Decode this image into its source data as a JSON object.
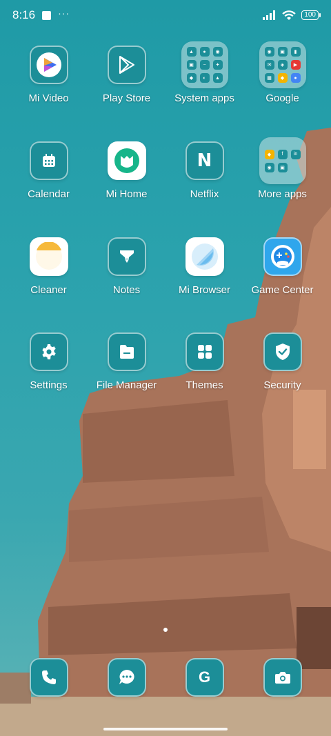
{
  "status_bar": {
    "time": "8:16",
    "extra": "···",
    "battery": "100"
  },
  "rows": [
    [
      {
        "label": "Mi Video",
        "icon": "mi-video-icon"
      },
      {
        "label": "Play Store",
        "icon": "play-store-icon"
      },
      {
        "label": "System apps",
        "icon": "folder-icon"
      },
      {
        "label": "Google",
        "icon": "folder-icon"
      }
    ],
    [
      {
        "label": "Calendar",
        "icon": "calendar-icon"
      },
      {
        "label": "Mi Home",
        "icon": "mi-home-icon"
      },
      {
        "label": "Netflix",
        "icon": "netflix-icon"
      },
      {
        "label": "More apps",
        "icon": "folder-icon"
      }
    ],
    [
      {
        "label": "Cleaner",
        "icon": "cleaner-icon"
      },
      {
        "label": "Notes",
        "icon": "notes-icon"
      },
      {
        "label": "Mi Browser",
        "icon": "browser-icon"
      },
      {
        "label": "Game Center",
        "icon": "gamepad-icon"
      }
    ],
    [
      {
        "label": "Settings",
        "icon": "gear-icon"
      },
      {
        "label": "File Manager",
        "icon": "file-manager-icon"
      },
      {
        "label": "Themes",
        "icon": "themes-icon"
      },
      {
        "label": "Security",
        "icon": "shield-icon"
      }
    ]
  ],
  "netflix_letter": "N",
  "dock": [
    {
      "name": "phone",
      "icon": "phone-icon"
    },
    {
      "name": "messages",
      "icon": "message-icon"
    },
    {
      "name": "google",
      "icon": "google-icon",
      "letter": "G"
    },
    {
      "name": "camera",
      "icon": "camera-icon"
    }
  ],
  "colors": {
    "icon_bg": "#1c8e98",
    "wallpaper_sky": "#2aa2ad",
    "temple": "#b07a5e"
  }
}
